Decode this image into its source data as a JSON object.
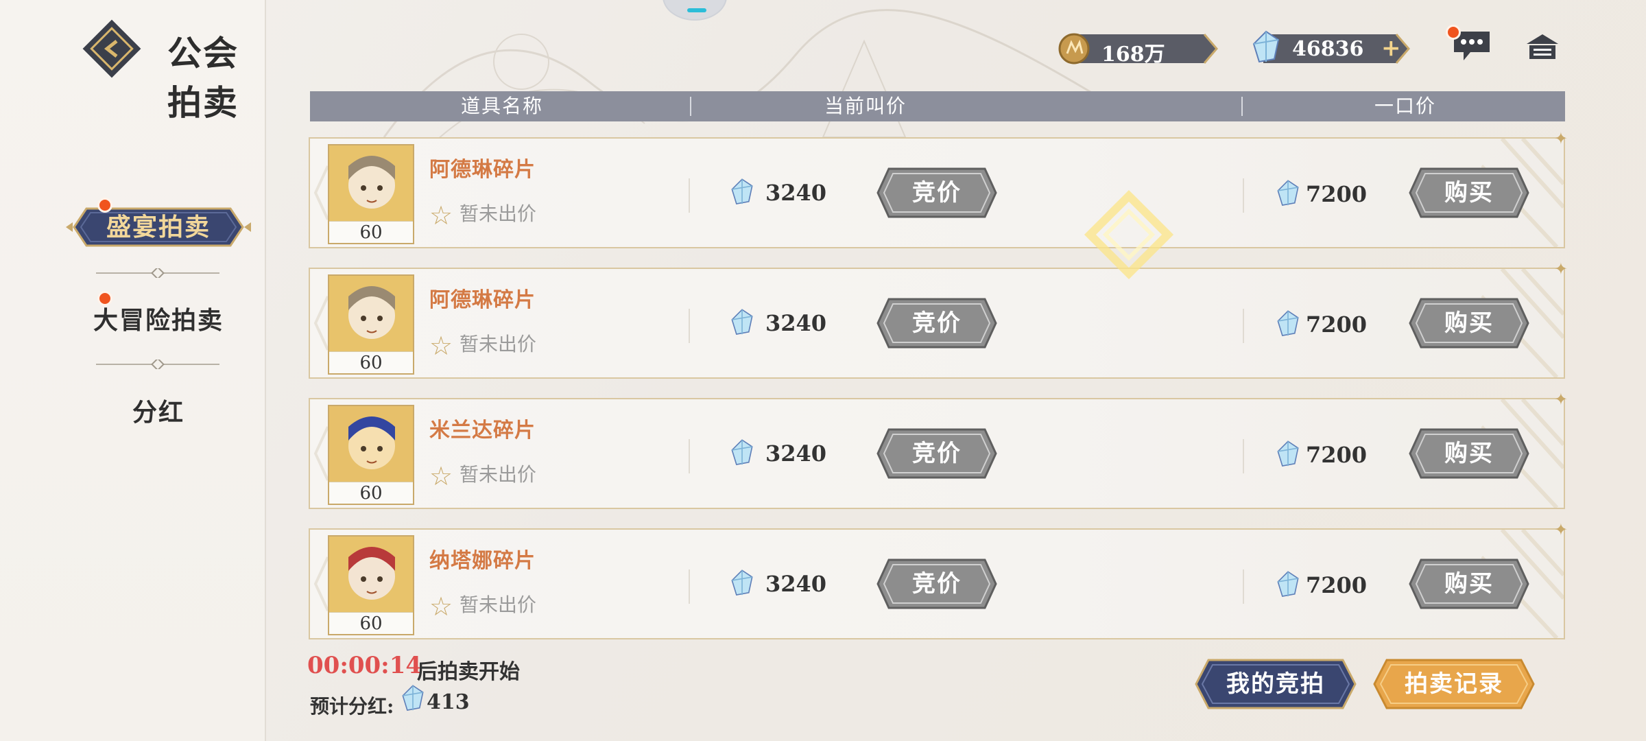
{
  "header": {
    "title": "公会拍卖",
    "gold_amount": "168万",
    "gem_amount": "46836",
    "gem_add": "+"
  },
  "sidebar": {
    "items": [
      {
        "label": "盛宴拍卖",
        "active": true,
        "badge": true
      },
      {
        "label": "大冒险拍卖",
        "active": false,
        "badge": true
      },
      {
        "label": "分红",
        "active": false,
        "badge": false
      }
    ]
  },
  "table": {
    "columns": [
      "道具名称",
      "当前叫价",
      "一口价"
    ],
    "rows": [
      {
        "name": "阿德琳碎片",
        "qty": "60",
        "status": "暂未出价",
        "current_bid": "3240",
        "bid_label": "竞价",
        "buyout": "7200",
        "buy_label": "购买"
      },
      {
        "name": "阿德琳碎片",
        "qty": "60",
        "status": "暂未出价",
        "current_bid": "3240",
        "bid_label": "竞价",
        "buyout": "7200",
        "buy_label": "购买"
      },
      {
        "name": "米兰达碎片",
        "qty": "60",
        "status": "暂未出价",
        "current_bid": "3240",
        "bid_label": "竞价",
        "buyout": "7200",
        "buy_label": "购买"
      },
      {
        "name": "纳塔娜碎片",
        "qty": "60",
        "status": "暂未出价",
        "current_bid": "3240",
        "bid_label": "竞价",
        "buyout": "7200",
        "buy_label": "购买"
      }
    ]
  },
  "footer": {
    "countdown": "00:00:14",
    "countdown_suffix": "后拍卖开始",
    "dividend_label": "预计分红:",
    "dividend_value": "413",
    "my_bids_label": "我的竞拍",
    "record_label": "拍卖记录"
  },
  "colors": {
    "accent_orange": "#d47a45",
    "countdown_red": "#e0504f",
    "nav_dark": "#3a4670",
    "gold_btn": "#e8a64b",
    "gray_btn": "#8d8d8d"
  }
}
